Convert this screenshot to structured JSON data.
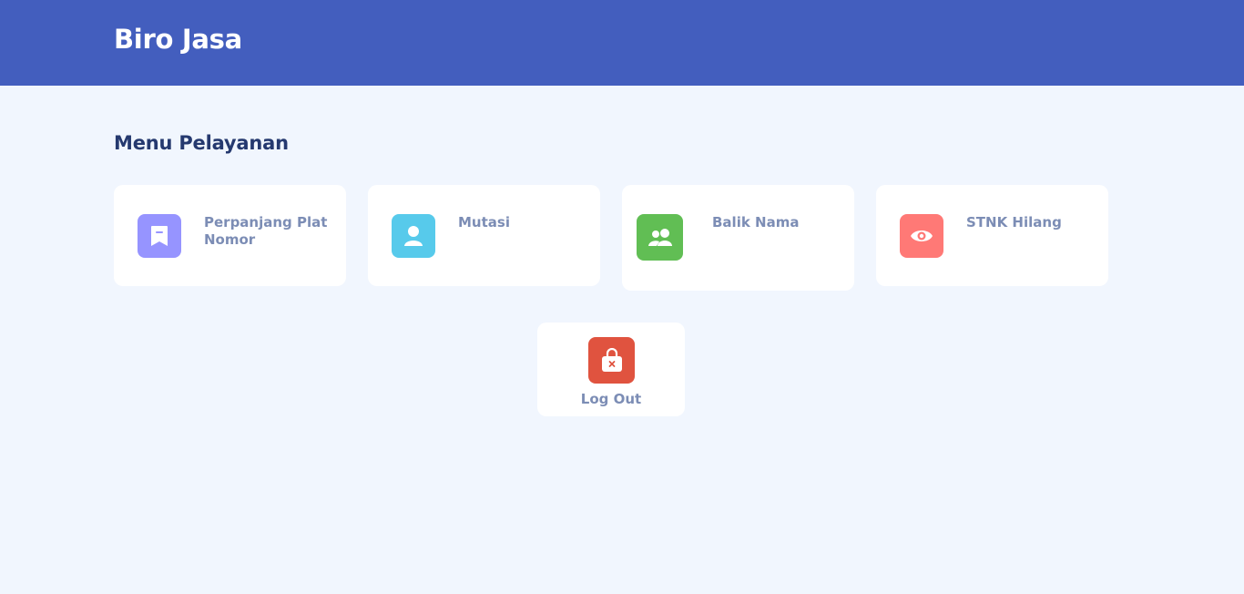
{
  "header": {
    "title": "Biro Jasa",
    "background": "#435ebe"
  },
  "main": {
    "section_title": "Menu Pelayanan",
    "menu": [
      {
        "label": "Perpanjang Plat Nomor",
        "icon": "bookmark-icon",
        "color": "#9694ff"
      },
      {
        "label": "Mutasi",
        "icon": "person-icon",
        "color": "#57caeb"
      },
      {
        "label": "Balik Nama",
        "icon": "people-icon",
        "color": "#5ddab4"
      },
      {
        "label": "STNK Hilang",
        "icon": "eye-icon",
        "color": "#ff7976"
      }
    ],
    "logout": {
      "label": "Log Out",
      "icon": "bag-x-icon",
      "color": "#e0533f"
    }
  }
}
